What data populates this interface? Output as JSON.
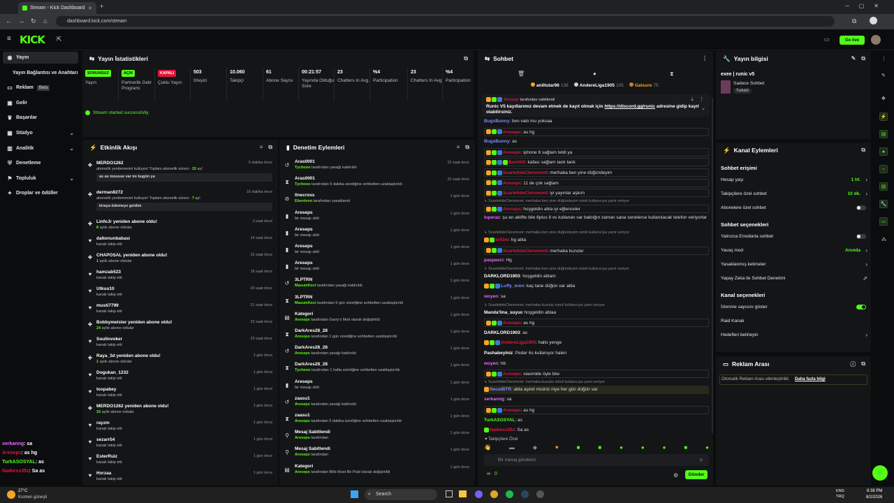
{
  "browser": {
    "tab_title": "Stream - Kick Dashboard",
    "url": "dashboard.kick.com/stream"
  },
  "topnav": {
    "logo": "KICK",
    "go_live": "Go live"
  },
  "leftnav": [
    {
      "label": "Yayın",
      "icon": "stream-icon"
    },
    {
      "label": "Yayın Bağlantısı ve Anahtarı",
      "icon": ""
    },
    {
      "label": "Reklam",
      "badge": "Beta",
      "icon": "ad-icon"
    },
    {
      "label": "Gelir",
      "icon": "money-icon"
    },
    {
      "label": "Başarılar",
      "icon": "trophy-icon"
    },
    {
      "label": "Stüdyo",
      "icon": "studio-icon"
    },
    {
      "label": "Analitik",
      "icon": "chart-icon"
    },
    {
      "label": "Denetleme",
      "icon": "shield-icon"
    },
    {
      "label": "Topluluk",
      "icon": "community-icon"
    },
    {
      "label": "Droplar ve ödüller",
      "icon": "gift-icon"
    }
  ],
  "stats": {
    "title": "Yayın İstatistikleri",
    "items": [
      {
        "tag": "SORUNSUZ",
        "tag_color": "#53fc18",
        "label": "Yayın"
      },
      {
        "tag": "AÇIK",
        "tag_color": "#53fc18",
        "label": "Partnerlik Gelir Programı"
      },
      {
        "tag": "KAPALI",
        "tag_color": "#e0173d",
        "label": "Çoklu Yayın"
      },
      {
        "value": "503",
        "label": "İzleyici"
      },
      {
        "value": "10.060",
        "label": "Takipçi"
      },
      {
        "value": "61",
        "label": "Abone Sayısı"
      },
      {
        "value": "00:21:57",
        "label": "Yayında Olduğu Süre"
      },
      {
        "value": "23",
        "label": "Chatters In Avg."
      },
      {
        "value": "%4",
        "label": "Participation"
      },
      {
        "value": "23",
        "label": "Chatters In Avg."
      },
      {
        "value": "%4",
        "label": "Participation"
      }
    ],
    "success": "Stream started successfully."
  },
  "activity": {
    "title": "Etkinlik Akışı",
    "items": [
      {
        "name": "MERDO1262",
        "desc": "abonelik yenilemesini kutluyor! Toplam abonelik süresi - ",
        "hl": "15",
        "desc2": " ay!",
        "msg": "as as mousse var mı bugün ya",
        "time": "5 dakika önce",
        "icon": "star-icon"
      },
      {
        "name": "derman8272",
        "desc": "abonelik yenilemesini kutluyor! Toplam abonelik süresi - ",
        "hl": "7",
        "desc2": " ay!",
        "msg": "kiraya ödemeye geldim",
        "time": "16 dakika önce",
        "icon": "star-icon"
      },
      {
        "name": "LinfoJr yeniden abone oldu!",
        "desc": "",
        "hl": "8",
        "desc2": " aylık abone oldular",
        "time": "3 saat önce",
        "icon": "star-icon"
      },
      {
        "name": "daltonunbabasi",
        "desc": "kanalı takip etti",
        "time": "14 saat önce",
        "icon": "heart-icon"
      },
      {
        "name": "CHAPOSAL yeniden abone oldu!",
        "desc": "",
        "hl": "1",
        "desc2": " aylık abone oldular",
        "time": "15 saat önce",
        "icon": "star-icon"
      },
      {
        "name": "hamzab523",
        "desc": "kanalı takip etti",
        "time": "18 saat önce",
        "icon": "heart-icon"
      },
      {
        "name": "Utkuu10",
        "desc": "kanalı takip etti",
        "time": "20 saat önce",
        "icon": "heart-icon"
      },
      {
        "name": "musti7799",
        "desc": "kanalı takip etti",
        "time": "21 saat önce",
        "icon": "heart-icon"
      },
      {
        "name": "Bobbymeister yeniden abone oldu!",
        "desc": "",
        "hl": "24",
        "desc2": " aylık abone oldular",
        "time": "22 saat önce",
        "icon": "star-icon"
      },
      {
        "name": "Soullnvoker",
        "desc": "kanalı takip etti",
        "time": "23 saat önce",
        "icon": "heart-icon"
      },
      {
        "name": "Raya_3d yeniden abone oldu!",
        "desc": "",
        "hl": "1",
        "desc2": " aylık abone oldular",
        "time": "1 gün önce",
        "icon": "star-icon"
      },
      {
        "name": "Dogukan_1232",
        "desc": "kanalı takip etti",
        "time": "1 gün önce",
        "icon": "heart-icon"
      },
      {
        "name": "tospabey",
        "desc": "kanalı takip etti",
        "time": "1 gün önce",
        "icon": "heart-icon"
      },
      {
        "name": "MERDO1262 yeniden abone oldu!",
        "desc": "",
        "hl": "15",
        "desc2": " aylık abone oldular",
        "time": "1 gün önce",
        "icon": "star-icon"
      },
      {
        "name": "rayzm",
        "desc": "kanalı takip etti",
        "time": "1 gün önce",
        "icon": "heart-icon"
      },
      {
        "name": "sezarr54",
        "desc": "kanalı takip etti",
        "time": "1 gün önce",
        "icon": "heart-icon"
      },
      {
        "name": "EsterRuiz",
        "desc": "kanalı takip etti",
        "time": "1 gün önce",
        "icon": "heart-icon"
      },
      {
        "name": "Hxrzaa",
        "desc": "kanalı takip etti",
        "time": "1 gün önce",
        "icon": "heart-icon"
      }
    ]
  },
  "moderation": {
    "title": "Denetim Eylemleri",
    "items": [
      {
        "name": "Aras0001",
        "actor": "Tychooo",
        "desc": " tarafından yasağı kaldırıldı",
        "time": "22 saat önce",
        "icon": "unban-icon"
      },
      {
        "name": "Aras0001",
        "actor": "Tychooo",
        "desc": " tarafından 5 dakika süreliğine sohbetten uzaklaştırıldı",
        "time": "22 saat önce",
        "icon": "timeout-icon"
      },
      {
        "name": "0necross",
        "actor": "Ebonivon",
        "desc": " tarafından yasaklandı",
        "time": "1 gün önce",
        "icon": "ban-icon"
      },
      {
        "name": "Areseps",
        "actor": "",
        "desc": "bir mesajı sildi",
        "time": "1 gün önce",
        "icon": "trash-icon"
      },
      {
        "name": "Areseps",
        "actor": "",
        "desc": "bir mesajı sildi",
        "time": "1 gün önce",
        "icon": "trash-icon"
      },
      {
        "name": "Areseps",
        "actor": "",
        "desc": "bir mesajı sildi",
        "time": "1 gün önce",
        "icon": "trash-icon"
      },
      {
        "name": "Areseps",
        "actor": "",
        "desc": "bir mesajı sildi",
        "time": "1 gün önce",
        "icon": "trash-icon"
      },
      {
        "name": "3LPTRN",
        "actor": "MasumKeci",
        "desc": " tarafından yasağı kaldırıldı",
        "time": "1 gün önce",
        "icon": "unban-icon"
      },
      {
        "name": "3LPTRN",
        "actor": "MasumKeci",
        "desc": " tarafından 5 gün süreliğine sohbetten uzaklaştırıldı",
        "time": "1 gün önce",
        "icon": "timeout-icon"
      },
      {
        "name": "Kategori",
        "actor": "Areseps",
        "desc": " tarafından Garry's Mod olarak değiştirildi",
        "time": "1 gün önce",
        "icon": "category-icon"
      },
      {
        "name": "DarkAres28_28",
        "actor": "Areseps",
        "desc": " tarafından 1 gün süreliğine sohbetten uzaklaştırıldı",
        "time": "1 gün önce",
        "icon": "timeout-icon"
      },
      {
        "name": "DarkAres28_28",
        "actor": "Areseps",
        "desc": " tarafından yasağı kaldırıldı",
        "time": "1 gün önce",
        "icon": "unban-icon"
      },
      {
        "name": "DarkAres28_28",
        "actor": "Tychooo",
        "desc": " tarafından 1 hafta süreliğine sohbetten uzaklaştırıldı",
        "time": "1 gün önce",
        "icon": "timeout-icon"
      },
      {
        "name": "Areseps",
        "actor": "",
        "desc": "bir mesajı sildi",
        "time": "1 gün önce",
        "icon": "trash-icon"
      },
      {
        "name": "zaasu1",
        "actor": "Areseps",
        "desc": " tarafından yasağı kaldırıldı",
        "time": "1 gün önce",
        "icon": "unban-icon"
      },
      {
        "name": "zaasu1",
        "actor": "Areseps",
        "desc": " tarafından 5 dakika süreliğine sohbetten uzaklaştırıldı",
        "time": "1 gün önce",
        "icon": "timeout-icon"
      },
      {
        "name": "Mesaj Sabitlendi",
        "actor": "Areseps",
        "desc": " tarafından",
        "time": "1 gün önce",
        "icon": "pin-icon"
      },
      {
        "name": "Mesaj Sabitlendi",
        "actor": "Areseps",
        "desc": " tarafından",
        "time": "1 gün önce",
        "icon": "pin-icon"
      },
      {
        "name": "Kategori",
        "actor": "Areseps",
        "desc": " tarafından Bills Must Be Paid olarak değiştirildi",
        "time": "1 gün önce",
        "icon": "category-icon"
      }
    ]
  },
  "chat": {
    "title": "Sohbet",
    "top_users": [
      {
        "name": "aniltutar96",
        "count": "138"
      },
      {
        "name": "AndereLiga1905",
        "count": "105"
      },
      {
        "name": "Gatsure",
        "count": "75"
      }
    ],
    "pinned_by": "tarafından sabitlendi",
    "pinned_text_1": "Runic V5 kayıtlarımız devam etmek de kayıt olmak için ",
    "pinned_link": "https://discord.gg/runic",
    "pinned_text_2": " adresine gidip kayıt olabilirsiniz.",
    "messages": [
      {
        "user": "BugsBunny",
        "color": "#7b8cff",
        "text": ": bvo valo mu yoksaa",
        "chips": []
      },
      {
        "user": "Areseps",
        "color": "#e0173d",
        "text": ": as hg",
        "chips": [
          "#f5a623",
          "#53fc18",
          "#3a7bd5"
        ],
        "boxed": true
      },
      {
        "user": "BugsBunny",
        "color": "#7b8cff",
        "text": ": as",
        "chips": []
      },
      {
        "user": "Areseps",
        "color": "#e0173d",
        "text": ": iphone 6 sağlam teldi ya",
        "chips": [
          "#f5a623",
          "#53fc18",
          "#3a7bd5"
        ],
        "boxed": true
      },
      {
        "user": "Bonitilli",
        "color": "#e0173d",
        "text": ": kafası sağlam tank tank",
        "chips": [
          "#f5a623",
          "#53fc18",
          "#3a7bd5",
          "#53fc18"
        ],
        "boxed": true
      },
      {
        "user": "ScarlettdeCleremont",
        "color": "#e0173d",
        "text": ": merhaba ben yine düğündeyim",
        "chips": [
          "#f5a623",
          "#53fc18",
          "#3a7bd5"
        ],
        "boxed": true
      },
      {
        "user": "Areseps",
        "color": "#e0173d",
        "text": ": 11 de çok sağlam",
        "chips": [
          "#f5a623",
          "#53fc18",
          "#3a7bd5"
        ],
        "boxed": true
      },
      {
        "user": "ScarlettdeCleremont",
        "color": "#e0173d",
        "text": ": iyi yayınlar aşkım",
        "chips": [
          "#f5a623",
          "#53fc18",
          "#3a7bd5"
        ],
        "boxed": true
      },
      {
        "reply": "ScarlettdeCleremont: merhaba ben yine düğündeyim isimli kullanıcıya yanıt veriyor",
        "user": "Areseps",
        "color": "#e0173d",
        "text": ": hoşgeldin abla iyi eğlenceler",
        "chips": [
          "#f5a623",
          "#53fc18",
          "#3a7bd5"
        ],
        "boxed": true
      },
      {
        "user": "luperaz",
        "color": "#e56bff",
        "text": ": şu an aktifte bile 6plus 8 vs kullanan var baktığın zaman sana senelerce kullanılacak telefon veriyorlar",
        "chips": [],
        "wrap": true
      },
      {
        "reply": "ScarlettdeCleremont: merhaba ben yine düğündeyim isimli kullanıcıya yanıt veriyor",
        "user": "ar43m",
        "color": "#e0173d",
        "text": ": hg abla",
        "chips": [
          "#f5a623",
          "#53fc18"
        ]
      },
      {
        "user": "ScarlettdeCleremont",
        "color": "#e0173d",
        "text": ": merhaba kuzular",
        "chips": [
          "#f5a623",
          "#53fc18",
          "#3a7bd5"
        ],
        "boxed": true
      },
      {
        "user": "paspasci",
        "color": "#e56bff",
        "text": ": Hg",
        "chips": []
      },
      {
        "reply": "ScarlettdeCleremont: merhaba ben yine düğündeyim isimli kullanıcıya yanıt veriyor",
        "user": "DARKLORD1903",
        "color": "#ffffff",
        "text": ": hoşgeldin ablam",
        "chips": []
      },
      {
        "user": "Luffy_eren",
        "color": "#7b8cff",
        "text": ": kaç tane düğün var abla",
        "chips": [
          "#f5a623",
          "#53fc18",
          "#3a7bd5"
        ]
      },
      {
        "user": "woyen",
        "color": "#e56bff",
        "text": ": sa",
        "chips": []
      },
      {
        "reply": "ScarlettdeCleremont: merhaba kuzular isimli kullanıcıya yanıt veriyor",
        "user": "Manda'lina_suyuc",
        "color": "#ffffff",
        "text": " hoşgeldin ablaa",
        "chips": []
      },
      {
        "user": "Areseps",
        "color": "#e0173d",
        "text": ": as hg",
        "chips": [
          "#f5a623",
          "#53fc18",
          "#3a7bd5"
        ],
        "boxed": true
      },
      {
        "user": "DARKLORD1903",
        "color": "#ffffff",
        "text": ": as",
        "chips": []
      },
      {
        "user": "AndereLiga1905",
        "color": "#e0173d",
        "text": ": hallo yenge",
        "chips": [
          "#f5a623",
          "#53fc18",
          "#3a7bd5"
        ]
      },
      {
        "user": "Pashabeyiniz",
        "color": "#ffffff",
        "text": ": Peder 6s kullanıyor halen",
        "chips": []
      },
      {
        "user": "woyen",
        "color": "#e56bff",
        "text": ": hb",
        "chips": []
      },
      {
        "user": "Areseps",
        "color": "#e0173d",
        "text": ": xiaomide öyle btw",
        "chips": [
          "#f5a623",
          "#53fc18",
          "#3a7bd5"
        ],
        "boxed": true
      },
      {
        "reply": "ScarlettdeCleremont: merhaba kuzular isimli kullanıcıya yanıt veriyor",
        "user": "NecatBTR",
        "color": "#7b8cff",
        "text": ": abla aşiret misiniz niye her gün düğün var",
        "chips": [
          "#f5a623"
        ],
        "highlight": true
      },
      {
        "user": "serkanng",
        "color": "#e56bff",
        "text": ": sa",
        "chips": []
      },
      {
        "user": "Areseps",
        "color": "#e0173d",
        "text": ": as hg",
        "chips": [
          "#f5a623",
          "#53fc18",
          "#3a7bd5"
        ],
        "boxed": true
      },
      {
        "user": "TurkASOSYAL",
        "color": "#53fc18",
        "text": ": as",
        "chips": []
      },
      {
        "user": "fawkess35z",
        "color": "#e0173d",
        "text": ": Sa as",
        "chips": [
          "#53fc18"
        ]
      }
    ],
    "followers_only": "Takipçilere Özel",
    "input_placeholder": "Bir mesaj gönderin",
    "send": "Gönder",
    "counter1": "∞",
    "counter2": "0"
  },
  "streaminfo": {
    "title": "Yayın bilgisi",
    "stream_title": "exee | runic v5",
    "category": "Sadece Sohbet",
    "tag": "Turkish"
  },
  "channel": {
    "title": "Kanal Eylemleri",
    "sec1": "Sohbet erişimi",
    "rows1": [
      {
        "label": "Hesap yaşı",
        "value": "1 hf.",
        "chev": true
      },
      {
        "label": "Takipçilere özel sohbet",
        "value": "10 dk.",
        "chev": true
      },
      {
        "label": "Abonelere özel sohbet",
        "toggle": false
      }
    ],
    "sec2": "Sohbet seçenekleri",
    "rows2": [
      {
        "label": "Yalnızca Emotlarla sohbet",
        "toggle": false
      },
      {
        "label": "Yavaş mod",
        "value": "Anında",
        "chev": true
      },
      {
        "label": "Yasaklanmış kelimeler",
        "chev": true
      },
      {
        "label": "Yapay Zeka ile Sohbet Denetimi",
        "ext": true
      }
    ],
    "sec3": "Kanal seçenekleri",
    "rows3": [
      {
        "label": "İzlenme sayısını göster",
        "toggle": true
      },
      {
        "label": "Raid Kanalı"
      },
      {
        "label": "Hedefleri belirleyin",
        "chev": true
      }
    ]
  },
  "ads": {
    "title": "Reklam Arası",
    "text": "Otomatik Reklam Arası etkinleştirildi.",
    "link": "Daha fazla bilgi"
  },
  "overlay_chat": [
    {
      "user": "serkanng",
      "color": "#e56bff",
      "text": ": sa"
    },
    {
      "user": "Areseps",
      "color": "#e0173d",
      "text": ": as hg"
    },
    {
      "user": "TurkASOSYAL",
      "color": "#53fc18",
      "text": ": as"
    },
    {
      "user": "fawkess35z",
      "color": "#e0173d",
      "text": ": Sa as"
    }
  ],
  "taskbar": {
    "weather_temp": "27°C",
    "weather_text": "Kısmen güneşli",
    "search": "Search",
    "lang1": "ENG",
    "lang2": "TRQ",
    "time": "8:38 PM",
    "date": "8/2/2026"
  }
}
